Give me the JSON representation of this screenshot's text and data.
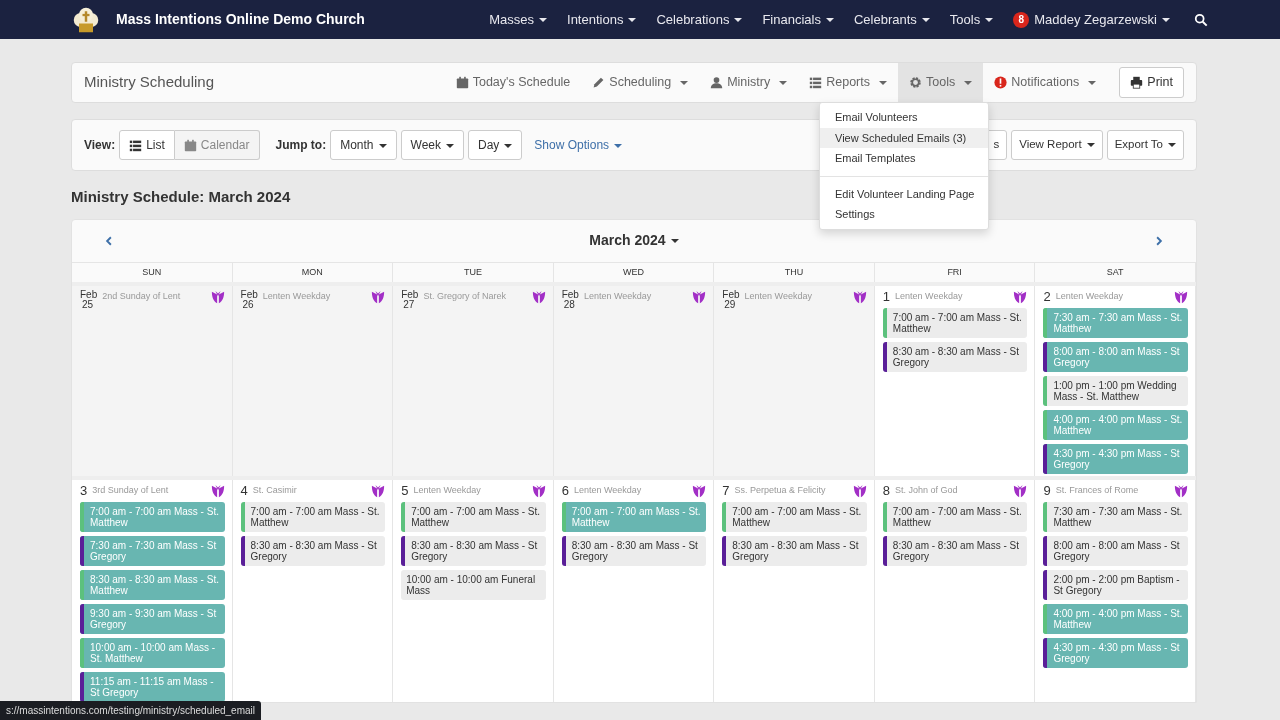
{
  "navbar": {
    "brand": "Mass Intentions Online Demo Church",
    "menus": [
      {
        "label": "Masses"
      },
      {
        "label": "Intentions"
      },
      {
        "label": "Celebrations"
      },
      {
        "label": "Financials"
      },
      {
        "label": "Celebrants"
      },
      {
        "label": "Tools"
      }
    ],
    "user": {
      "badge": "8",
      "name": "Maddey Zegarzewski"
    }
  },
  "header": {
    "title": "Ministry Scheduling",
    "menus": [
      {
        "kind": "calendar",
        "label": "Today's Schedule",
        "caret": false,
        "open": false
      },
      {
        "kind": "pencil",
        "label": "Scheduling",
        "caret": true,
        "open": false
      },
      {
        "kind": "person",
        "label": "Ministry",
        "caret": true,
        "open": false
      },
      {
        "kind": "list",
        "label": "Reports",
        "caret": true,
        "open": false
      },
      {
        "kind": "gear",
        "label": "Tools",
        "caret": true,
        "open": true
      },
      {
        "kind": "alert",
        "label": "Notifications",
        "caret": true,
        "open": false
      }
    ],
    "print": "Print"
  },
  "tools_menu": [
    {
      "label": "Email Volunteers",
      "hovered": false
    },
    {
      "label": "View Scheduled Emails (3)",
      "hovered": true
    },
    {
      "label": "Email Templates",
      "hovered": false
    },
    {
      "kind": "divider"
    },
    {
      "label": "Edit Volunteer Landing Page",
      "hovered": false
    },
    {
      "label": "Settings",
      "hovered": false
    }
  ],
  "toolbar": {
    "view_label": "View:",
    "views": [
      {
        "kind": "list",
        "label": "List",
        "selected": false
      },
      {
        "kind": "calendar",
        "label": "Calendar",
        "selected": true
      }
    ],
    "jump_label": "Jump to:",
    "jumps": [
      "Month",
      "Week",
      "Day"
    ],
    "show_options": "Show Options",
    "right_buttons": [
      {
        "label": "s",
        "caret": false
      },
      {
        "label": "View Report",
        "caret": true
      },
      {
        "label": "Export To",
        "caret": true
      }
    ]
  },
  "schedule_title": "Ministry Schedule: March 2024",
  "calendar": {
    "month": "March 2024",
    "weekdays": [
      "SUN",
      "MON",
      "TUE",
      "WED",
      "THU",
      "FRI",
      "SAT"
    ],
    "weeks": [
      {
        "days": [
          {
            "month": "Feb",
            "day": "25",
            "feast": "2nd Sunday of Lent",
            "other_month": true
          },
          {
            "month": "Feb",
            "day": "26",
            "feast": "Lenten Weekday",
            "other_month": true
          },
          {
            "month": "Feb",
            "day": "27",
            "feast": "St. Gregory of Narek",
            "other_month": true
          },
          {
            "month": "Feb",
            "day": "28",
            "feast": "Lenten Weekday",
            "other_month": true
          },
          {
            "month": "Feb",
            "day": "29",
            "feast": "Lenten Weekday",
            "other_month": true
          },
          {
            "day": "1",
            "feast": "Lenten Weekday",
            "other_month": false,
            "events": [
              {
                "text": "7:00 am - 7:00 am Mass - St. Matthew",
                "color": "#5cc17d",
                "highlighted": false
              },
              {
                "text": "8:30 am - 8:30 am Mass - St Gregory",
                "color": "#5a1f98",
                "highlighted": false
              }
            ]
          },
          {
            "day": "2",
            "feast": "Lenten Weekday",
            "other_month": false,
            "events": [
              {
                "text": "7:30 am - 7:30 am Mass - St. Matthew",
                "color": "#5cc17d",
                "highlighted": true
              },
              {
                "text": "8:00 am - 8:00 am Mass - St Gregory",
                "color": "#5a1f98",
                "highlighted": true
              },
              {
                "text": "1:00 pm - 1:00 pm Wedding Mass - St. Matthew",
                "color": "#5cc17d",
                "highlighted": false
              },
              {
                "text": "4:00 pm - 4:00 pm Mass - St. Matthew",
                "color": "#5cc17d",
                "highlighted": true
              },
              {
                "text": "4:30 pm - 4:30 pm Mass - St Gregory",
                "color": "#5a1f98",
                "highlighted": true
              }
            ]
          }
        ]
      },
      {
        "days": [
          {
            "day": "3",
            "feast": "3rd Sunday of Lent",
            "other_month": false,
            "events": [
              {
                "text": "7:00 am - 7:00 am Mass - St. Matthew",
                "color": "#5cc17d",
                "highlighted": true
              },
              {
                "text": "7:30 am - 7:30 am Mass - St Gregory",
                "color": "#5a1f98",
                "highlighted": true
              },
              {
                "text": "8:30 am - 8:30 am Mass - St. Matthew",
                "color": "#5cc17d",
                "highlighted": true
              },
              {
                "text": "9:30 am - 9:30 am Mass - St Gregory",
                "color": "#5a1f98",
                "highlighted": true
              },
              {
                "text": "10:00 am - 10:00 am Mass - St. Matthew",
                "color": "#5cc17d",
                "highlighted": true
              },
              {
                "text": "11:15 am - 11:15 am Mass - St Gregory",
                "color": "#5a1f98",
                "highlighted": true
              }
            ]
          },
          {
            "day": "4",
            "feast": "St. Casimir",
            "other_month": false,
            "events": [
              {
                "text": "7:00 am - 7:00 am Mass - St. Matthew",
                "color": "#5cc17d",
                "highlighted": false
              },
              {
                "text": "8:30 am - 8:30 am Mass - St Gregory",
                "color": "#5a1f98",
                "highlighted": false
              }
            ]
          },
          {
            "day": "5",
            "feast": "Lenten Weekday",
            "other_month": false,
            "events": [
              {
                "text": "7:00 am - 7:00 am Mass - St. Matthew",
                "color": "#5cc17d",
                "highlighted": false
              },
              {
                "text": "8:30 am - 8:30 am Mass - St Gregory",
                "color": "#5a1f98",
                "highlighted": false
              },
              {
                "text": "10:00 am - 10:00 am Funeral Mass",
                "highlighted": false
              }
            ]
          },
          {
            "day": "6",
            "feast": "Lenten Weekday",
            "other_month": false,
            "events": [
              {
                "text": "7:00 am - 7:00 am Mass - St. Matthew",
                "color": "#5cc17d",
                "highlighted": true
              },
              {
                "text": "8:30 am - 8:30 am Mass - St Gregory",
                "color": "#5a1f98",
                "highlighted": false
              }
            ]
          },
          {
            "day": "7",
            "feast": "Ss. Perpetua & Felicity",
            "other_month": false,
            "events": [
              {
                "text": "7:00 am - 7:00 am Mass - St. Matthew",
                "color": "#5cc17d",
                "highlighted": false
              },
              {
                "text": "8:30 am - 8:30 am Mass - St Gregory",
                "color": "#5a1f98",
                "highlighted": false
              }
            ]
          },
          {
            "day": "8",
            "feast": "St. John of God",
            "other_month": false,
            "events": [
              {
                "text": "7:00 am - 7:00 am Mass - St. Matthew",
                "color": "#5cc17d",
                "highlighted": false
              },
              {
                "text": "8:30 am - 8:30 am Mass - St Gregory",
                "color": "#5a1f98",
                "highlighted": false
              }
            ]
          },
          {
            "day": "9",
            "feast": "St. Frances of Rome",
            "other_month": false,
            "events": [
              {
                "text": "7:30 am - 7:30 am Mass - St. Matthew",
                "color": "#5cc17d",
                "highlighted": false
              },
              {
                "text": "8:00 am - 8:00 am Mass - St Gregory",
                "color": "#5a1f98",
                "highlighted": false
              },
              {
                "text": "2:00 pm - 2:00 pm Baptism - St Gregory",
                "color": "#5a1f98",
                "highlighted": false
              },
              {
                "text": "4:00 pm - 4:00 pm Mass - St. Matthew",
                "color": "#5cc17d",
                "highlighted": true
              },
              {
                "text": "4:30 pm - 4:30 pm Mass - St Gregory",
                "color": "#5a1f98",
                "highlighted": true
              }
            ]
          }
        ]
      }
    ]
  },
  "status_bar": "s://massintentions.com/testing/ministry/scheduled_email"
}
